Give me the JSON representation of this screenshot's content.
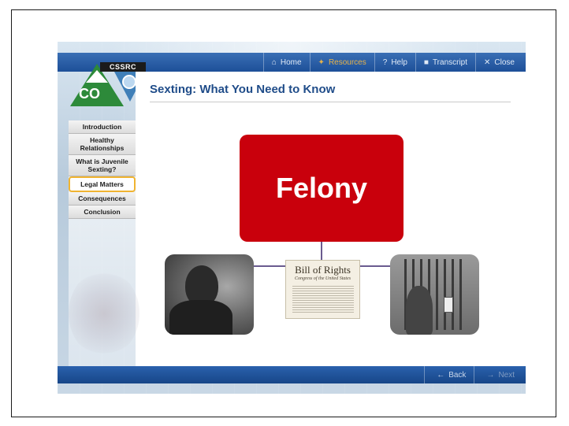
{
  "nav": {
    "items": [
      {
        "icon": "home-icon",
        "glyph": "⌂",
        "label": "Home"
      },
      {
        "icon": "resources-icon",
        "glyph": "✦",
        "label": "Resources"
      },
      {
        "icon": "help-icon",
        "glyph": "?",
        "label": "Help"
      },
      {
        "icon": "transcript-icon",
        "glyph": "■",
        "label": "Transcript"
      },
      {
        "icon": "close-icon",
        "glyph": "✕",
        "label": "Close"
      }
    ],
    "active_color": "#e6b24a"
  },
  "logo": {
    "co_text": "CO",
    "cssrc_text": "CSSRC",
    "green": "#2d8a3a",
    "blue": "#3f7fb8"
  },
  "page": {
    "title": "Sexting: What You Need to Know"
  },
  "sidebar": {
    "items": [
      {
        "label": "Introduction",
        "active": false
      },
      {
        "label": "Healthy Relationships",
        "active": false
      },
      {
        "label": "What is Juvenile Sexting?",
        "active": false
      },
      {
        "label": "Legal Matters",
        "active": true
      },
      {
        "label": "Consequences",
        "active": false
      },
      {
        "label": "Conclusion",
        "active": false
      }
    ],
    "highlight_color": "#f0b431"
  },
  "graphic": {
    "felony_label": "Felony",
    "felony_color": "#c9000c",
    "document_title": "Bill of Rights",
    "document_subtitle": "Congress of the United States",
    "connector_color": "#6a5b8f"
  },
  "footer": {
    "back_label": "Back",
    "next_label": "Next"
  }
}
